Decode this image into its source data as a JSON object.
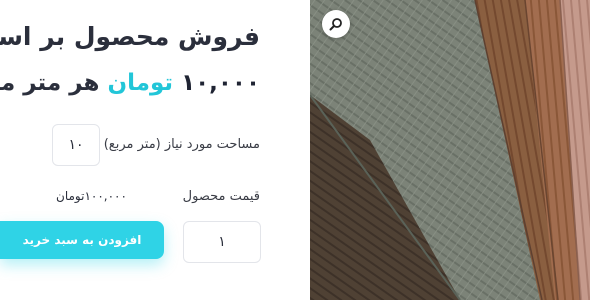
{
  "product": {
    "title": "فروش محصول بر اساس",
    "price_number": "۱۰,۰۰۰",
    "price_currency": "تومان",
    "price_unit": "هر متر مربع"
  },
  "area": {
    "label": "مساحت مورد نیاز (متر مربع)",
    "value": "۱۰"
  },
  "pricing": {
    "label": "قیمت محصول",
    "total": "۱۰۰,۰۰۰تومان"
  },
  "quantity": {
    "value": "۱"
  },
  "actions": {
    "add_to_cart": "افزودن به سبد خرید"
  },
  "icons": {
    "zoom": "search-icon"
  },
  "colors": {
    "accent": "#2fd3e6",
    "currency": "#22c6d8",
    "text": "#2b2f3c"
  }
}
